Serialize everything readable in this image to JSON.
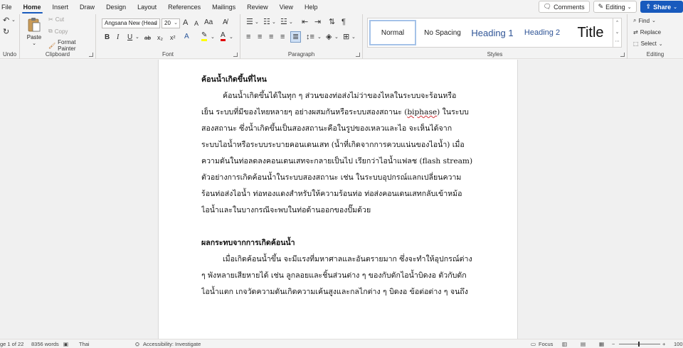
{
  "menu": [
    "File",
    "Home",
    "Insert",
    "Draw",
    "Design",
    "Layout",
    "References",
    "Mailings",
    "Review",
    "View",
    "Help"
  ],
  "actions": {
    "comments": "Comments",
    "editing": "Editing",
    "share": "Share"
  },
  "ribbon": {
    "undo_label": "Undo",
    "clipboard": {
      "paste": "Paste",
      "cut": "Cut",
      "copy": "Copy",
      "format_painter": "Format Painter",
      "label": "Clipboard"
    },
    "font": {
      "name": "Angsana New (Head",
      "size": "20",
      "label": "Font",
      "grow": "A",
      "shrink": "A",
      "case": "Aa"
    },
    "paragraph": {
      "label": "Paragraph"
    },
    "styles": {
      "items": [
        "Normal",
        "No Spacing",
        "Heading 1",
        "Heading 2",
        "Title"
      ],
      "label": "Styles"
    },
    "editing": {
      "find": "Find",
      "replace": "Replace",
      "select": "Select",
      "label": "Editing"
    }
  },
  "document": {
    "heading1": "ค้อนน้ำเกิดขึ้นที่ไหน",
    "para1": [
      "ค้อนน้ำเกิดขึ้นได้ในทุก ๆ ส่วนของท่อส่งไม่ว่าของไหลในระบบจะร้อนหรือ",
      "เย็น ระบบที่มีของไหยหลายๆ อย่างผสมกันหรือระบบสองสถานะ (",
      "biphase",
      ") ในระบบ",
      "สองสถานะ ซึ่งน้ำเกิดขึ้นเป็นสองสถานะคือในรูปของเหลวและไอ จะเห็นได้จาก",
      "ระบบไอน้ำหรือระบบระบายคอนเดนเสท (น้ำที่เกิดจากการควบแน่นของไอน้ำ) เมื่อ",
      "ความดันในท่อลดลงคอนเดนเสทจะกลายเป็นไป เรียกว่าไอน้ำแฟลช (flash stream)",
      "ตัวอย่างการเกิดค้อนน้ำในระบบสองสถานะ เช่น ในระบบอุปกรณ์แลกเปลี่ยนความ",
      "ร้อนท่อส่งไอน้ำ ท่อทองแดงสำหรับให้ความร้อนท่อ ท่อส่งคอนเดนเสทกลับเข้าหม้อ",
      "ไอน้ำและในบางกรณีจะพบในท่อด้านออกของปั๊มด้วย"
    ],
    "heading2": "ผลกระทบจากการเกิดค้อนน้ำ",
    "para2": [
      "เมื่อเกิดค้อนน้ำขึ้น จะมีแรงที่มหาศาลและอันตรายมาก ซึ่งจะทำให้อุปกรณ์ต่าง",
      "ๆ พังหลายเสียหายได้ เช่น ลูกลอยและชิ้นส่วนต่าง ๆ ของกับดักไอน้ำบิดงอ ตัวกับดัก",
      "ไอน้ำแตก เกจวัดความดันเกิดความเค้นสูงและกลไกต่าง ๆ บิดงอ ข้อต่อต่าง ๆ จนถึง"
    ]
  },
  "status": {
    "page": "ge 1 of 22",
    "words": "8356 words",
    "language": "Thai",
    "accessibility": "Accessibility: Investigate",
    "focus": "Focus",
    "zoom": "100"
  },
  "colors": {
    "accent": "#185abd",
    "heading_style": "#2f5496",
    "highlight": "#ffff00",
    "font_color": "#e00000"
  }
}
